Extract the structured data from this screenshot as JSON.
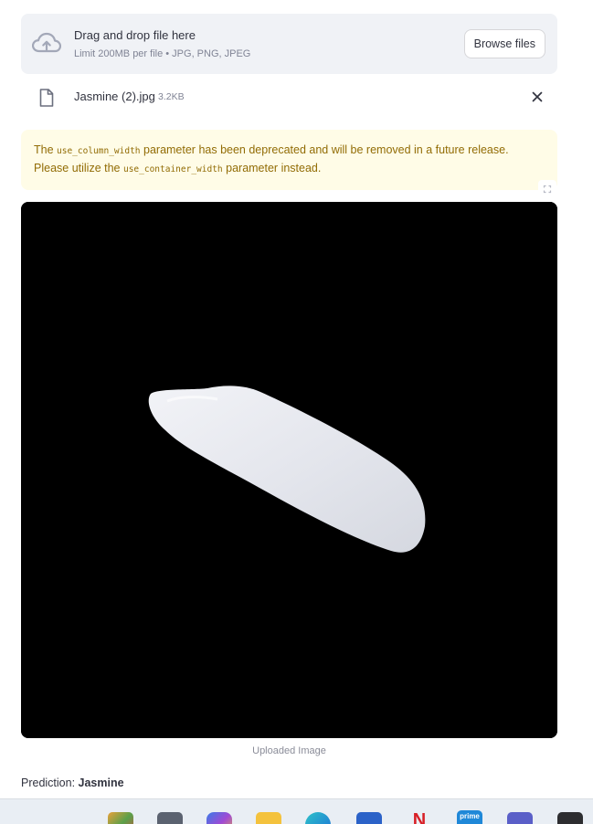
{
  "uploader": {
    "title": "Drag and drop file here",
    "subtitle": "Limit 200MB per file • JPG, PNG, JPEG",
    "browse_label": "Browse files",
    "icon": "cloud-upload-icon"
  },
  "file": {
    "name": "Jasmine (2).jpg",
    "size": "3.2KB",
    "icon": "file-icon",
    "remove_icon": "close-icon"
  },
  "warning": {
    "part1": "The ",
    "code1": "use_column_width",
    "part2": " parameter has been deprecated and will be removed in a future release. Please utilize the ",
    "code2": "use_container_width",
    "part3": " parameter instead."
  },
  "image": {
    "caption": "Uploaded Image"
  },
  "prediction": {
    "label": "Prediction: ",
    "value": "Jasmine"
  },
  "taskbar": {
    "icons": [
      "store-icon",
      "app-icon",
      "copilot-icon",
      "file-explorer-icon",
      "edge-icon",
      "store-bag-icon",
      "netflix-icon",
      "prime-video-icon",
      "teams-icon",
      "terminal-icon"
    ],
    "prime_label": "prime",
    "netflix_label": "N"
  },
  "colors": {
    "warning_bg": "#fffce7",
    "warning_text": "#926c05",
    "dropzone_bg": "#f0f2f6"
  }
}
